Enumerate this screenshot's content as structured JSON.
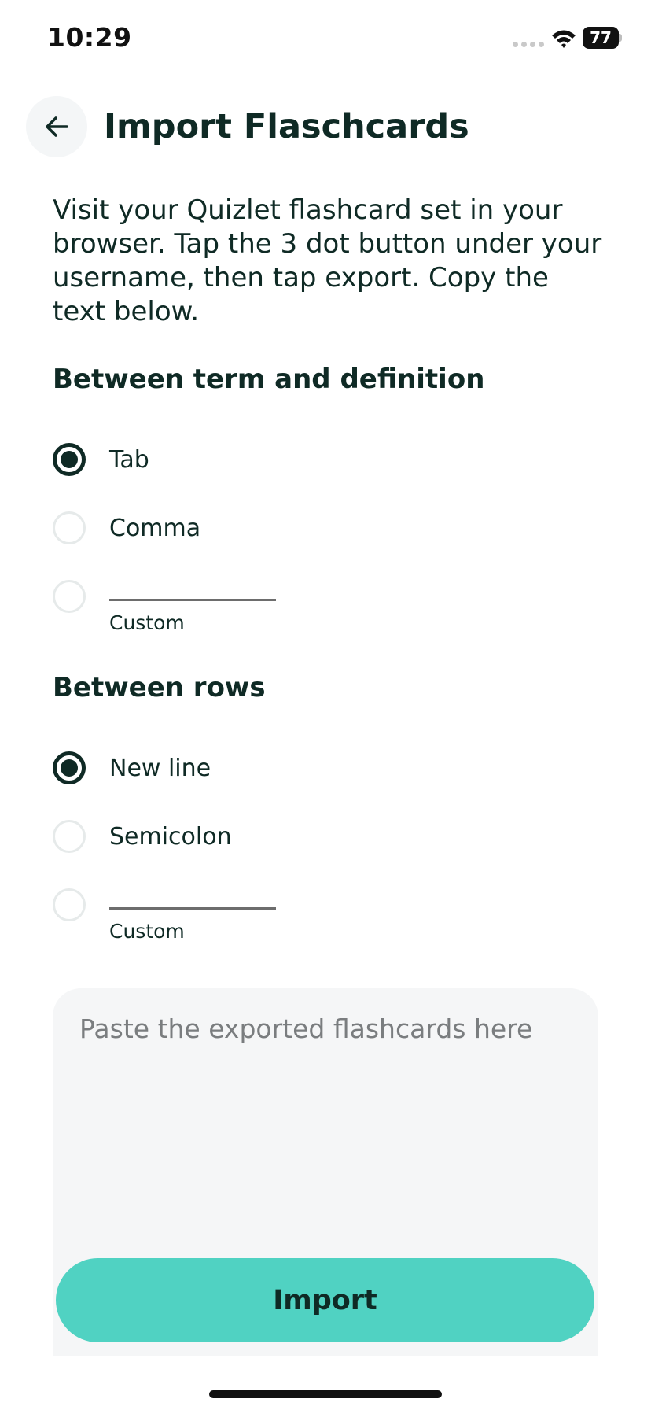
{
  "status_bar": {
    "time": "10:29",
    "battery": "77"
  },
  "header": {
    "title": "Import Flaschcards",
    "back_icon": "arrow-left-icon"
  },
  "intro": "Visit your Quizlet flashcard set in your browser. Tap the 3 dot button under your username, then tap export. Copy the text below.",
  "term_separator": {
    "heading": "Between term and definition",
    "options": [
      {
        "label": "Tab",
        "selected": true
      },
      {
        "label": "Comma",
        "selected": false
      }
    ],
    "custom": {
      "value": "",
      "caption": "Custom",
      "selected": false
    }
  },
  "row_separator": {
    "heading": "Between rows",
    "options": [
      {
        "label": "New line",
        "selected": true
      },
      {
        "label": "Semicolon",
        "selected": false
      }
    ],
    "custom": {
      "value": "",
      "caption": "Custom",
      "selected": false
    }
  },
  "paste": {
    "placeholder": "Paste the exported flashcards here",
    "value": ""
  },
  "import_button": {
    "label": "Import"
  },
  "colors": {
    "accent": "#50d2c2",
    "text": "#0f2a25",
    "surface": "#f5f6f7"
  }
}
